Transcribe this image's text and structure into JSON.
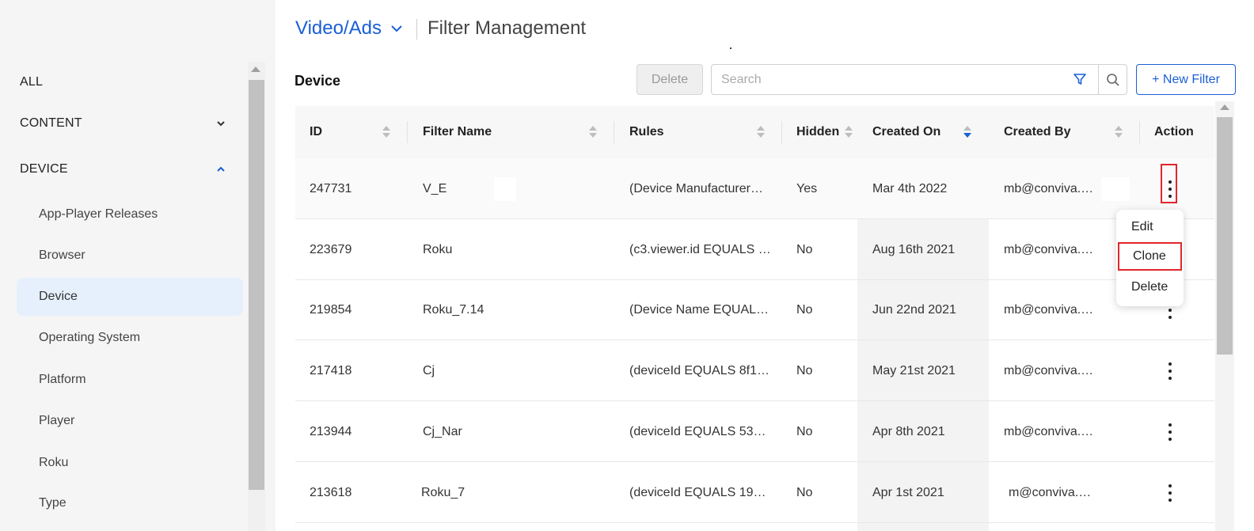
{
  "header": {
    "breadcrumb": "Video/Ads",
    "title": "Filter Management"
  },
  "sidebar": {
    "items": [
      {
        "label": "ALL"
      },
      {
        "label": "CONTENT"
      },
      {
        "label": "DEVICE"
      }
    ],
    "subitems": [
      {
        "label": "App-Player Releases"
      },
      {
        "label": "Browser"
      },
      {
        "label": "Device"
      },
      {
        "label": "Operating System"
      },
      {
        "label": "Platform"
      },
      {
        "label": "Player"
      },
      {
        "label": "Roku"
      },
      {
        "label": "Type"
      }
    ],
    "active_item": "Device"
  },
  "toolbar": {
    "section_title": "Device",
    "delete_label": "Delete",
    "search_placeholder": "Search",
    "new_filter_label": "+ New Filter"
  },
  "table": {
    "columns": [
      "ID",
      "Filter Name",
      "Rules",
      "Hidden",
      "Created On",
      "Created By",
      "Action"
    ],
    "rows": [
      {
        "id": "247731",
        "name": "V_E",
        "rules": "(Device Manufacturer…",
        "hidden": "Yes",
        "created_on": "Mar 4th 2022",
        "created_by": "mb@conviva.…"
      },
      {
        "id": "223679",
        "name": "Roku",
        "rules": "(c3.viewer.id EQUALS …",
        "hidden": "No",
        "created_on": "Aug 16th 2021",
        "created_by": "mb@conviva.…"
      },
      {
        "id": "219854",
        "name": "Roku_7.14",
        "rules": "(Device Name EQUAL…",
        "hidden": "No",
        "created_on": "Jun 22nd 2021",
        "created_by": "mb@conviva.…"
      },
      {
        "id": "217418",
        "name": "Cj",
        "rules": "(deviceId EQUALS 8f1…",
        "hidden": "No",
        "created_on": "May 21st 2021",
        "created_by": "mb@conviva.…"
      },
      {
        "id": "213944",
        "name": "Cj_Nar",
        "rules": "(deviceId EQUALS 53…",
        "hidden": "No",
        "created_on": "Apr 8th 2021",
        "created_by": "mb@conviva.…"
      },
      {
        "id": "213618",
        "name": "Roku_7",
        "rules": "(deviceId EQUALS 19…",
        "hidden": "No",
        "created_on": "Apr 1st 2021",
        "created_by": "m@conviva.…"
      }
    ]
  },
  "context_menu": {
    "items": [
      "Edit",
      "Clone",
      "Delete"
    ]
  },
  "colors": {
    "accent": "#1a5fd4",
    "highlight_box": "#e0262b",
    "active_sidebar_bg": "#e6f0fc"
  }
}
